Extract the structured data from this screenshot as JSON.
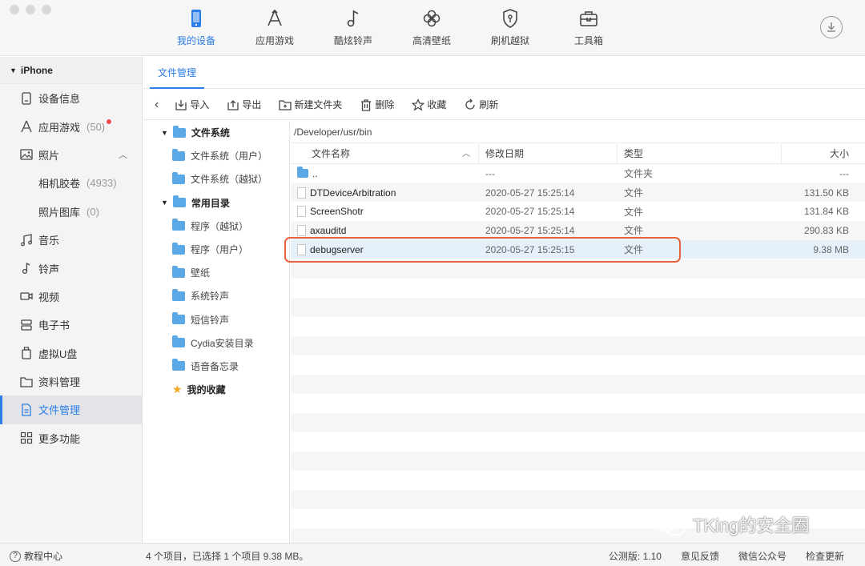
{
  "toolbar_nav": [
    {
      "label": "我的设备",
      "icon": "phone-icon",
      "active": true
    },
    {
      "label": "应用游戏",
      "icon": "app-store-icon",
      "active": false
    },
    {
      "label": "酷炫铃声",
      "icon": "music-note-icon",
      "active": false
    },
    {
      "label": "高清壁纸",
      "icon": "flower-icon",
      "active": false
    },
    {
      "label": "刷机越狱",
      "icon": "shield-icon",
      "active": false
    },
    {
      "label": "工具箱",
      "icon": "toolbox-icon",
      "active": false
    }
  ],
  "sidebar": {
    "device": "iPhone",
    "items": [
      {
        "label": "设备信息",
        "icon": "device-info-icon"
      },
      {
        "label": "应用游戏",
        "icon": "app-store-icon",
        "count": "(50)"
      },
      {
        "label": "照片",
        "icon": "photo-icon"
      },
      {
        "label": "相机胶卷",
        "count": "(4933)"
      },
      {
        "label": "照片图库",
        "count": "(0)"
      },
      {
        "label": "音乐",
        "icon": "music-icon"
      },
      {
        "label": "铃声",
        "icon": "ringtone-icon"
      },
      {
        "label": "视频",
        "icon": "video-icon"
      },
      {
        "label": "电子书",
        "icon": "ebook-icon"
      },
      {
        "label": "虚拟U盘",
        "icon": "usb-icon"
      },
      {
        "label": "资料管理",
        "icon": "folder-icon"
      },
      {
        "label": "文件管理",
        "icon": "file-icon"
      },
      {
        "label": "更多功能",
        "icon": "grid-icon"
      }
    ]
  },
  "tab": "文件管理",
  "actions": {
    "import": "导入",
    "export": "导出",
    "new_folder": "新建文件夹",
    "delete": "删除",
    "favorite": "收藏",
    "refresh": "刷新"
  },
  "tree": {
    "filesystem": "文件系统",
    "fs_user": "文件系统（用户）",
    "fs_jailbreak": "文件系统（越狱）",
    "common": "常用目录",
    "apps_jailbreak": "程序（越狱）",
    "apps_user": "程序（用户）",
    "wallpaper": "壁纸",
    "system_ringtones": "系统铃声",
    "sms_ringtones": "短信铃声",
    "cydia": "Cydia安装目录",
    "voice_memos": "语音备忘录",
    "favorites": "我的收藏"
  },
  "path": "/Developer/usr/bin",
  "columns": {
    "name": "文件名称",
    "modified": "修改日期",
    "type": "类型",
    "size": "大小"
  },
  "files": [
    {
      "name": "..",
      "modified": "---",
      "type": "文件夹",
      "size": "---",
      "kind": "folder"
    },
    {
      "name": "DTDeviceArbitration",
      "modified": "2020-05-27 15:25:14",
      "type": "文件",
      "size": "131.50 KB",
      "kind": "file"
    },
    {
      "name": "ScreenShotr",
      "modified": "2020-05-27 15:25:14",
      "type": "文件",
      "size": "131.84 KB",
      "kind": "file"
    },
    {
      "name": "axauditd",
      "modified": "2020-05-27 15:25:14",
      "type": "文件",
      "size": "290.83 KB",
      "kind": "file"
    },
    {
      "name": "debugserver",
      "modified": "2020-05-27 15:25:15",
      "type": "文件",
      "size": "9.38 MB",
      "kind": "file",
      "selected": true
    }
  ],
  "status": {
    "help": "教程中心",
    "summary": "4 个项目，已选择 1 个项目 9.38 MB。",
    "version": "公测版: 1.10",
    "feedback": "意见反馈",
    "wechat": "微信公众号",
    "update": "检查更新"
  },
  "watermark": "TKing的安全圈",
  "colors": {
    "accent": "#2b7de9",
    "highlight": "#e8623f",
    "badge": "#f04b4b"
  }
}
